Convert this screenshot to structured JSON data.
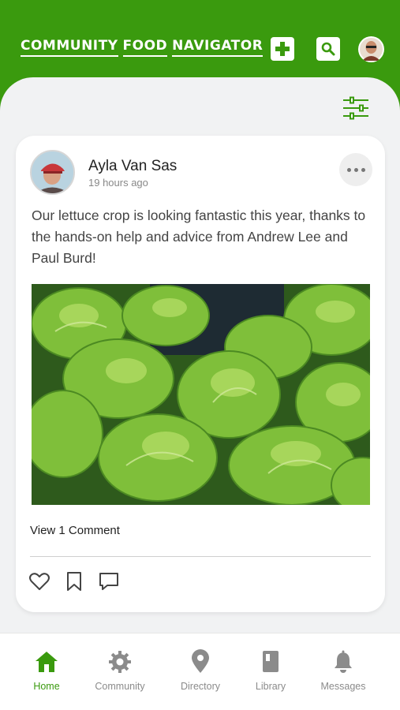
{
  "header": {
    "logo_words": [
      "COMMUNITY",
      "FOOD",
      "NAVIGATOR"
    ]
  },
  "post": {
    "author": "Ayla Van Sas",
    "time": "19 hours ago",
    "text": "Our lettuce crop is looking fantastic this year, thanks to the hands-on help and advice from Andrew Lee and Paul Burd!",
    "comments_link": "View 1 Comment"
  },
  "tabs": [
    {
      "label": "Home",
      "icon": "home-icon",
      "active": true
    },
    {
      "label": "Community",
      "icon": "gear-icon",
      "active": false
    },
    {
      "label": "Directory",
      "icon": "map-pin-icon",
      "active": false
    },
    {
      "label": "Library",
      "icon": "book-icon",
      "active": false
    },
    {
      "label": "Messages",
      "icon": "bell-icon",
      "active": false
    }
  ],
  "colors": {
    "brand_green": "#3a9a0e",
    "tab_inactive": "#8b8b8b",
    "sheet_bg": "#f1f2f3"
  }
}
